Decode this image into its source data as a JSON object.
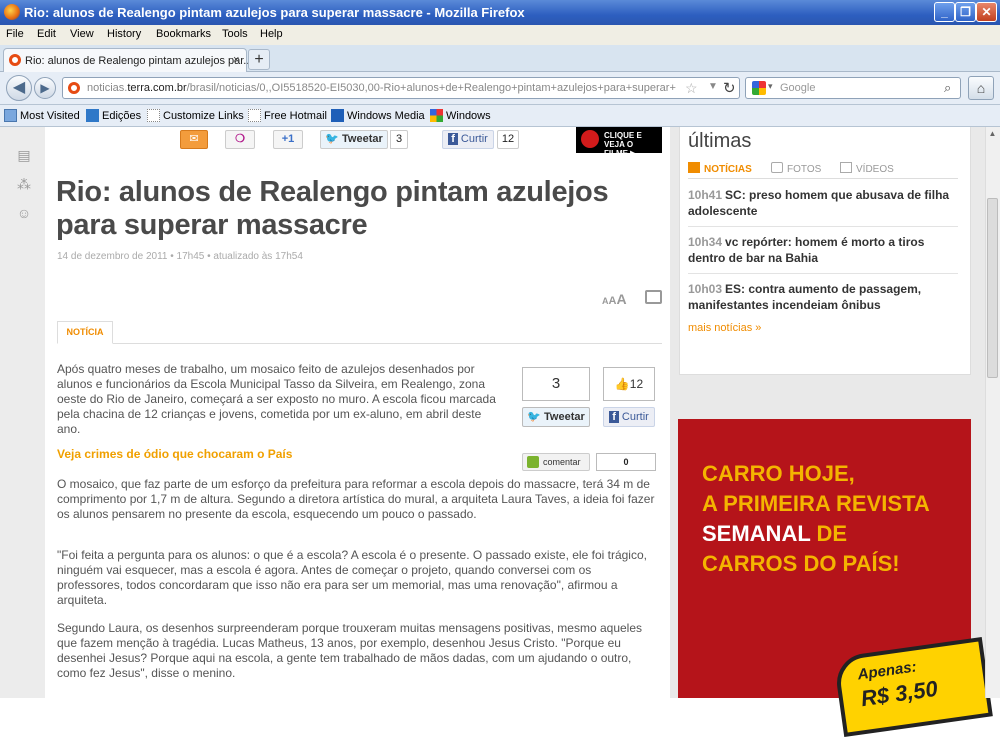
{
  "window": {
    "title": "Rio: alunos de Realengo pintam azulejos para superar massacre - Mozilla Firefox",
    "controls": [
      "_",
      "❐",
      "✕"
    ]
  },
  "menu": [
    "File",
    "Edit",
    "View",
    "History",
    "Bookmarks",
    "Tools",
    "Help"
  ],
  "tab": {
    "title": "Rio: alunos de Realengo pintam azulejos par...",
    "close": "×",
    "new": "+"
  },
  "nav": {
    "back": "◀",
    "forward": "▶",
    "url_pre": "noticias.",
    "url_domain": "terra.com.br",
    "url_rest": "/brasil/noticias/0,,OI5518520-EI5030,00-Rio+alunos+de+Realengo+pintam+azulejos+para+superar+",
    "search_placeholder": "Google",
    "home": "⌂"
  },
  "bookmarks": [
    "Most Visited",
    "Edições",
    "Customize Links",
    "Free Hotmail",
    "Windows Media",
    "Windows"
  ],
  "share": {
    "plus": "+1",
    "tweet": "Tweetar",
    "tweet_count": "3",
    "like": "Curtir",
    "like_count": "12"
  },
  "promo": "CLIQUE E VEJA O FILME ▶",
  "article": {
    "title": "Rio: alunos de Realengo pintam azulejos para superar massacre",
    "date": "14 de dezembro de 2011 • 17h45 • atualizado às 17h54",
    "font_size": "AAA",
    "tab": "NOTÍCIA",
    "p1": "Após quatro meses de trabalho, um mosaico feito de azulejos desenhados por alunos e funcionários da Escola Municipal Tasso da Silveira, em Realengo, zona oeste do Rio de Janeiro, começará a ser exposto no muro. A escola ficou marcada pela chacina de 12 crianças e jovens, cometida por um ex-aluno, em abril deste ano.",
    "related": "Veja crimes de ódio que chocaram o País",
    "p2": "O mosaico, que faz parte de um esforço da prefeitura para reformar a escola depois do massacre, terá 34 m de comprimento por 1,7 m de altura. Segundo a diretora artística do mural, a arquiteta Laura Taves, a ideia foi fazer os alunos pensarem no presente da escola, esquecendo um pouco o passado.",
    "p3": "\"Foi feita a pergunta para os alunos: o que é a escola? A escola é o presente. O passado existe, ele foi trágico, ninguém vai esquecer, mas a escola é agora. Antes de começar o projeto, quando conversei com os professores, todos concordaram que isso não era para ser um memorial, mas uma renovação\", afirmou a arquiteta.",
    "p4": "Segundo Laura, os desenhos surpreenderam porque trouxeram muitas mensagens positivas, mesmo aqueles que fazem menção à tragédia. Lucas Matheus, 13 anos, por exemplo, desenhou Jesus Cristo. \"Porque eu desenhei Jesus? Porque aqui na escola, a gente tem trabalhado de mãos dadas, com um ajudando o outro, como fez Jesus\", disse o menino."
  },
  "social": {
    "tweet_count": "3",
    "tweet_label": "Tweetar",
    "like_count": "12",
    "like_label": "Curtir",
    "comment_label": "comentar",
    "comment_count": "0"
  },
  "sidebar": {
    "heading": "últimas",
    "tabs": [
      "NOTÍCIAS",
      "FOTOS",
      "VÍDEOS"
    ],
    "news": [
      {
        "time": "10h41",
        "text": "SC: preso homem que abusava de filha adolescente"
      },
      {
        "time": "10h34",
        "text": "vc repórter: homem é morto a tiros dentro de bar na Bahia"
      },
      {
        "time": "10h03",
        "text": "ES: contra aumento de passagem, manifestantes incendeiam ônibus"
      }
    ],
    "more": "mais notícias »"
  },
  "ad": {
    "l1": "CARRO HOJE,",
    "l2": "A PRIMEIRA REVISTA",
    "l3a": "SEMANAL",
    "l3b": " DE",
    "l4": "CARROS DO PAÍS!",
    "sticker1": "Apenas:",
    "sticker2": "R$ 3,50"
  },
  "colors": {
    "accent": "#f08c00",
    "ad_bg": "#b5141a",
    "ad_text": "#f4b400"
  }
}
